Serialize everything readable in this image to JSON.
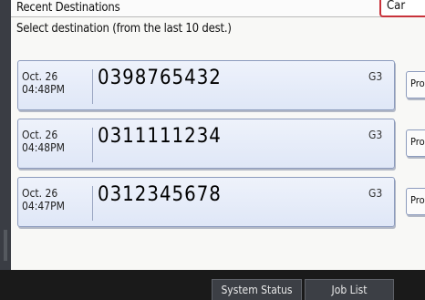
{
  "header": {
    "title": "Recent Destinations",
    "cancel_label": "Car"
  },
  "subtitle": "Select destination (from the last 10 dest.)",
  "destinations": [
    {
      "date": "Oct. 26",
      "time": "04:48PM",
      "number": "0398765432",
      "mode": "G3",
      "prog_label": "Pro"
    },
    {
      "date": "Oct. 26",
      "time": "04:48PM",
      "number": "0311111234",
      "mode": "G3",
      "prog_label": "Pro"
    },
    {
      "date": "Oct. 26",
      "time": "04:47PM",
      "number": "0312345678",
      "mode": "G3",
      "prog_label": "Pro"
    }
  ],
  "footer": {
    "system_status": "System Status",
    "job_list": "Job List"
  }
}
